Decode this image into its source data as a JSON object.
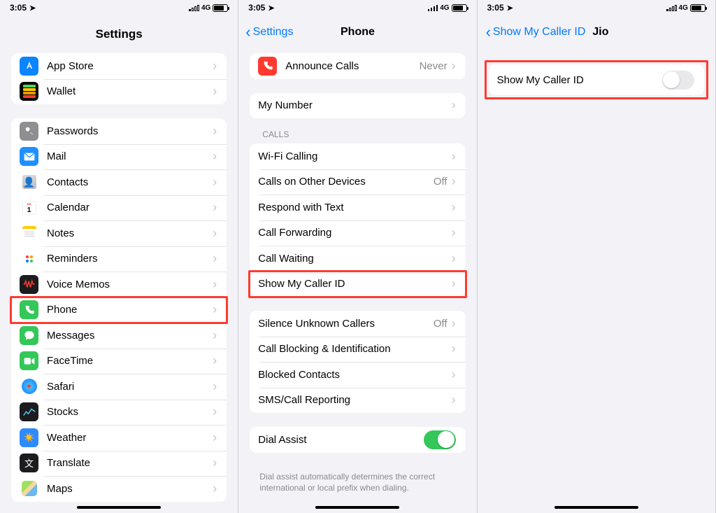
{
  "status": {
    "time": "3:05",
    "network_label": "4G"
  },
  "pane1": {
    "title": "Settings",
    "groupA": [
      {
        "label": "App Store",
        "bg": "#0a84ff",
        "glyph": "A",
        "name": "app-store"
      },
      {
        "label": "Wallet",
        "bg": "#000",
        "glyph": "▮",
        "name": "wallet"
      }
    ],
    "groupB": [
      {
        "label": "Passwords",
        "bg": "#8e8e93",
        "glyph": "🔑",
        "name": "passwords"
      },
      {
        "label": "Mail",
        "bg": "#1e90ff",
        "glyph": "✉",
        "name": "mail"
      },
      {
        "label": "Contacts",
        "bg": "#fff",
        "glyph": "",
        "name": "contacts"
      },
      {
        "label": "Calendar",
        "bg": "#fff",
        "glyph": "",
        "name": "calendar"
      },
      {
        "label": "Notes",
        "bg": "#fff",
        "glyph": "",
        "name": "notes"
      },
      {
        "label": "Reminders",
        "bg": "#fff",
        "glyph": "",
        "name": "reminders"
      },
      {
        "label": "Voice Memos",
        "bg": "#1c1c1e",
        "glyph": "",
        "name": "voice-memos"
      },
      {
        "label": "Phone",
        "bg": "#34c759",
        "glyph": "phone",
        "name": "phone"
      },
      {
        "label": "Messages",
        "bg": "#34c759",
        "glyph": "💬",
        "name": "messages"
      },
      {
        "label": "FaceTime",
        "bg": "#34c759",
        "glyph": "■",
        "name": "facetime"
      },
      {
        "label": "Safari",
        "bg": "#fff",
        "glyph": "🧭",
        "name": "safari"
      },
      {
        "label": "Stocks",
        "bg": "#1c1c1e",
        "glyph": "",
        "name": "stocks"
      },
      {
        "label": "Weather",
        "bg": "#2e8bff",
        "glyph": "☀",
        "name": "weather"
      },
      {
        "label": "Translate",
        "bg": "#1c1c1e",
        "glyph": "⇄",
        "name": "translate"
      },
      {
        "label": "Maps",
        "bg": "#fff",
        "glyph": "",
        "name": "maps"
      }
    ]
  },
  "pane2": {
    "back": "Settings",
    "title": "Phone",
    "announce": {
      "label": "Announce Calls",
      "detail": "Never"
    },
    "mynumber_label": "My Number",
    "calls_header": "CALLS",
    "calls": [
      {
        "label": "Wi-Fi Calling",
        "detail": "",
        "name": "wifi-calling"
      },
      {
        "label": "Calls on Other Devices",
        "detail": "Off",
        "name": "calls-other-devices"
      },
      {
        "label": "Respond with Text",
        "detail": "",
        "name": "respond-with-text"
      },
      {
        "label": "Call Forwarding",
        "detail": "",
        "name": "call-forwarding"
      },
      {
        "label": "Call Waiting",
        "detail": "",
        "name": "call-waiting"
      },
      {
        "label": "Show My Caller ID",
        "detail": "",
        "name": "show-my-caller-id"
      }
    ],
    "groupC": [
      {
        "label": "Silence Unknown Callers",
        "detail": "Off",
        "name": "silence-unknown"
      },
      {
        "label": "Call Blocking & Identification",
        "detail": "",
        "name": "call-blocking"
      },
      {
        "label": "Blocked Contacts",
        "detail": "",
        "name": "blocked-contacts"
      },
      {
        "label": "SMS/Call Reporting",
        "detail": "",
        "name": "sms-call-reporting"
      }
    ],
    "dial_assist_label": "Dial Assist",
    "dial_assist_footer": "Dial assist automatically determines the correct international or local prefix when dialing."
  },
  "pane3": {
    "back": "Show My Caller ID",
    "title": "Jio",
    "row_label": "Show My Caller ID"
  }
}
